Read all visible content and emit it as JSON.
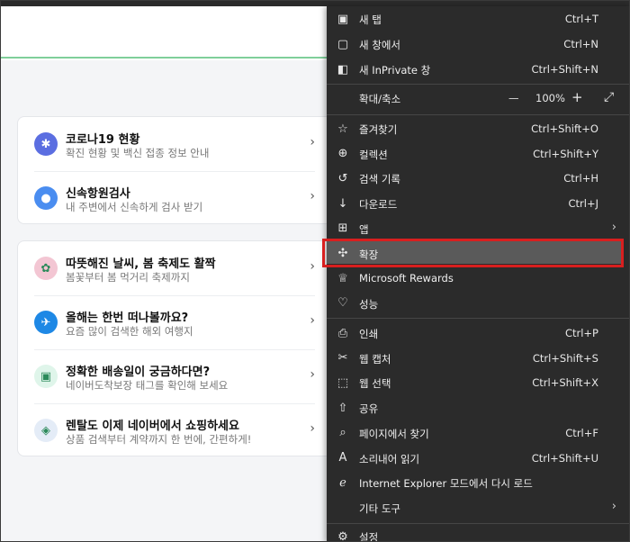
{
  "cards": [
    [
      {
        "title": "코로나19 현황",
        "subtitle": "확진 현황 및 백신 접종 정보 안내",
        "icon": "virus-icon",
        "color": "#5b6ee1"
      },
      {
        "title": "신속항원검사",
        "subtitle": "내 주변에서 신속하게 검사 받기",
        "icon": "location-pin-icon",
        "color": "#4a8df0"
      }
    ],
    [
      {
        "title": "따뜻해진 날씨, 봄 축제도 활짝",
        "subtitle": "봄꽃부터 봄 먹거리 축제까지",
        "icon": "cherry-blossom-icon",
        "color": "#f3c6d3"
      },
      {
        "title": "올해는 한번 떠나볼까요?",
        "subtitle": "요즘 많이 검색한 해외 여행지",
        "icon": "airplane-icon",
        "color": "#1e88e5"
      },
      {
        "title": "정확한 배송일이 궁금하다면?",
        "subtitle": "네이버도착보장 태그를 확인해 보세요",
        "icon": "delivery-truck-icon",
        "color": "#dff5ea"
      },
      {
        "title": "렌탈도 이제 네이버에서 쇼핑하세요",
        "subtitle": "상품 검색부터 계약까지 한 번에, 간편하게!",
        "icon": "price-tag-icon",
        "color": "#e4ecf7"
      }
    ]
  ],
  "menu": {
    "items_top": [
      {
        "label": "새 탭",
        "shortcut": "Ctrl+T",
        "icon": "new-tab-icon"
      },
      {
        "label": "새 창에서",
        "shortcut": "Ctrl+N",
        "icon": "new-window-icon"
      },
      {
        "label": "새 InPrivate 창",
        "shortcut": "Ctrl+Shift+N",
        "icon": "inprivate-icon"
      }
    ],
    "zoom": {
      "label": "확대/축소",
      "minus": "—",
      "value": "100%",
      "plus": "+"
    },
    "items_mid": [
      {
        "label": "즐겨찾기",
        "shortcut": "Ctrl+Shift+O",
        "icon": "favorites-icon"
      },
      {
        "label": "컬렉션",
        "shortcut": "Ctrl+Shift+Y",
        "icon": "collections-icon"
      },
      {
        "label": "검색 기록",
        "shortcut": "Ctrl+H",
        "icon": "history-icon"
      },
      {
        "label": "다운로드",
        "shortcut": "Ctrl+J",
        "icon": "download-icon"
      },
      {
        "label": "앱",
        "shortcut": "",
        "icon": "apps-icon",
        "arrow": true
      },
      {
        "label": "확장",
        "shortcut": "",
        "icon": "extensions-icon",
        "highlighted": true
      },
      {
        "label": "Microsoft Rewards",
        "shortcut": "",
        "icon": "rewards-icon"
      },
      {
        "label": "성능",
        "shortcut": "",
        "icon": "performance-icon"
      }
    ],
    "items_bottom": [
      {
        "label": "인쇄",
        "shortcut": "Ctrl+P",
        "icon": "print-icon"
      },
      {
        "label": "웹 캡처",
        "shortcut": "Ctrl+Shift+S",
        "icon": "web-capture-icon"
      },
      {
        "label": "웹 선택",
        "shortcut": "Ctrl+Shift+X",
        "icon": "web-select-icon"
      },
      {
        "label": "공유",
        "shortcut": "",
        "icon": "share-icon"
      },
      {
        "label": "페이지에서 찾기",
        "shortcut": "Ctrl+F",
        "icon": "find-icon"
      },
      {
        "label": "소리내어 읽기",
        "shortcut": "Ctrl+Shift+U",
        "icon": "read-aloud-icon"
      },
      {
        "label": "Internet Explorer 모드에서 다시 로드",
        "shortcut": "",
        "icon": "ie-mode-icon"
      },
      {
        "label": "기타 도구",
        "shortcut": "",
        "icon": "",
        "arrow": true
      }
    ],
    "settings": {
      "label": "설정",
      "icon": "gear-icon"
    }
  }
}
